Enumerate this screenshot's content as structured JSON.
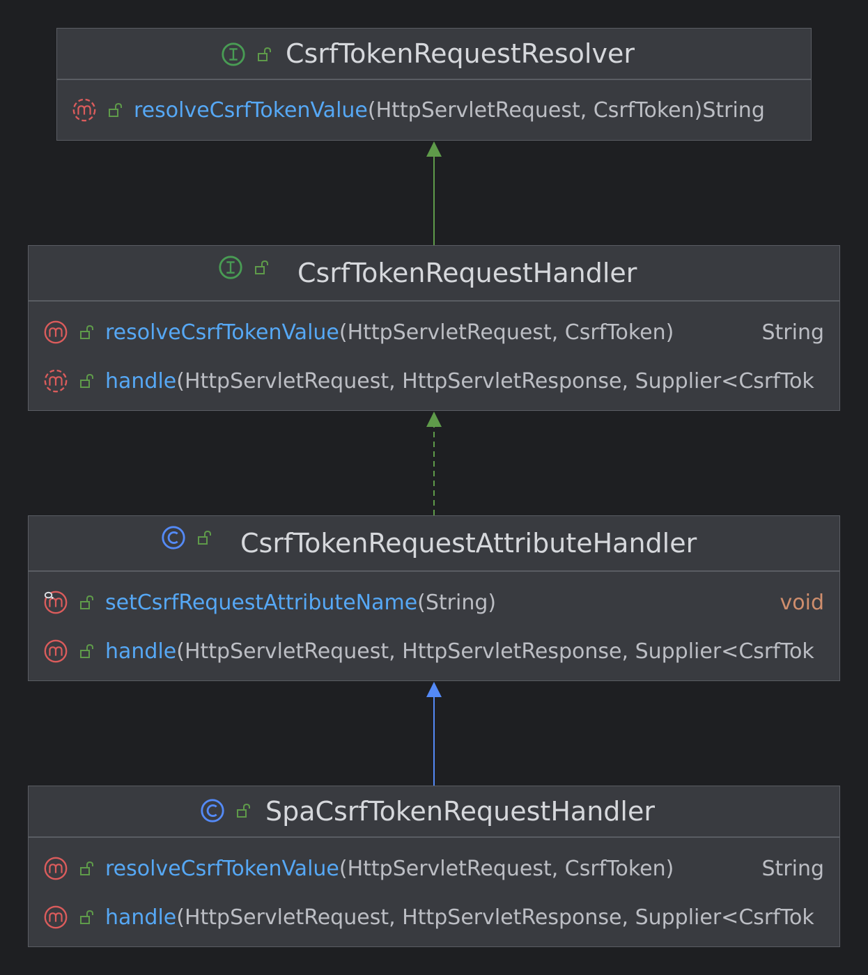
{
  "colors": {
    "background": "#1e1f22",
    "box": "#393b40",
    "border": "#5a5d63",
    "method_name": "#56a8f5",
    "interface_icon": "#499c54",
    "class_icon": "#548af7",
    "method_icon": "#db5c5c",
    "void_keyword": "#cf8e6d",
    "arrow_extends": "#5f9b4a",
    "arrow_class": "#548af7"
  },
  "nodes": [
    {
      "kind": "interface",
      "kind_icon": "interface-icon",
      "name": "CsrfTokenRequestResolver",
      "methods": [
        {
          "icon": "abstract-method-icon",
          "name": "resolveCsrfTokenValue",
          "params": "(HttpServletRequest, CsrfToken)",
          "return": " String"
        }
      ]
    },
    {
      "kind": "interface",
      "kind_icon": "interface-icon",
      "name": "CsrfTokenRequestHandler",
      "methods": [
        {
          "icon": "method-icon",
          "name": "resolveCsrfTokenValue",
          "params": "(HttpServletRequest, CsrfToken)",
          "return": "String"
        },
        {
          "icon": "abstract-method-icon",
          "name": "handle",
          "params": "(HttpServletRequest, HttpServletResponse, Supplier<CsrfTok",
          "return": ""
        }
      ]
    },
    {
      "kind": "class",
      "kind_icon": "class-icon",
      "name": "CsrfTokenRequestAttributeHandler",
      "methods": [
        {
          "icon": "setter-method-icon",
          "name": "setCsrfRequestAttributeName",
          "params": "(String)",
          "return": "void"
        },
        {
          "icon": "method-icon",
          "name": "handle",
          "params": "(HttpServletRequest, HttpServletResponse, Supplier<CsrfTok",
          "return": ""
        }
      ]
    },
    {
      "kind": "class",
      "kind_icon": "class-icon",
      "name": "SpaCsrfTokenRequestHandler",
      "methods": [
        {
          "icon": "method-icon",
          "name": "resolveCsrfTokenValue",
          "params": "(HttpServletRequest, CsrfToken)",
          "return": "String"
        },
        {
          "icon": "method-icon",
          "name": "handle",
          "params": "(HttpServletRequest, HttpServletResponse, Supplier<CsrfTok",
          "return": ""
        }
      ]
    }
  ],
  "edges": [
    {
      "from": "CsrfTokenRequestHandler",
      "to": "CsrfTokenRequestResolver",
      "type": "extends",
      "style": "solid"
    },
    {
      "from": "CsrfTokenRequestAttributeHandler",
      "to": "CsrfTokenRequestHandler",
      "type": "implements",
      "style": "dashed"
    },
    {
      "from": "SpaCsrfTokenRequestHandler",
      "to": "CsrfTokenRequestAttributeHandler",
      "type": "extends",
      "style": "solid"
    }
  ]
}
